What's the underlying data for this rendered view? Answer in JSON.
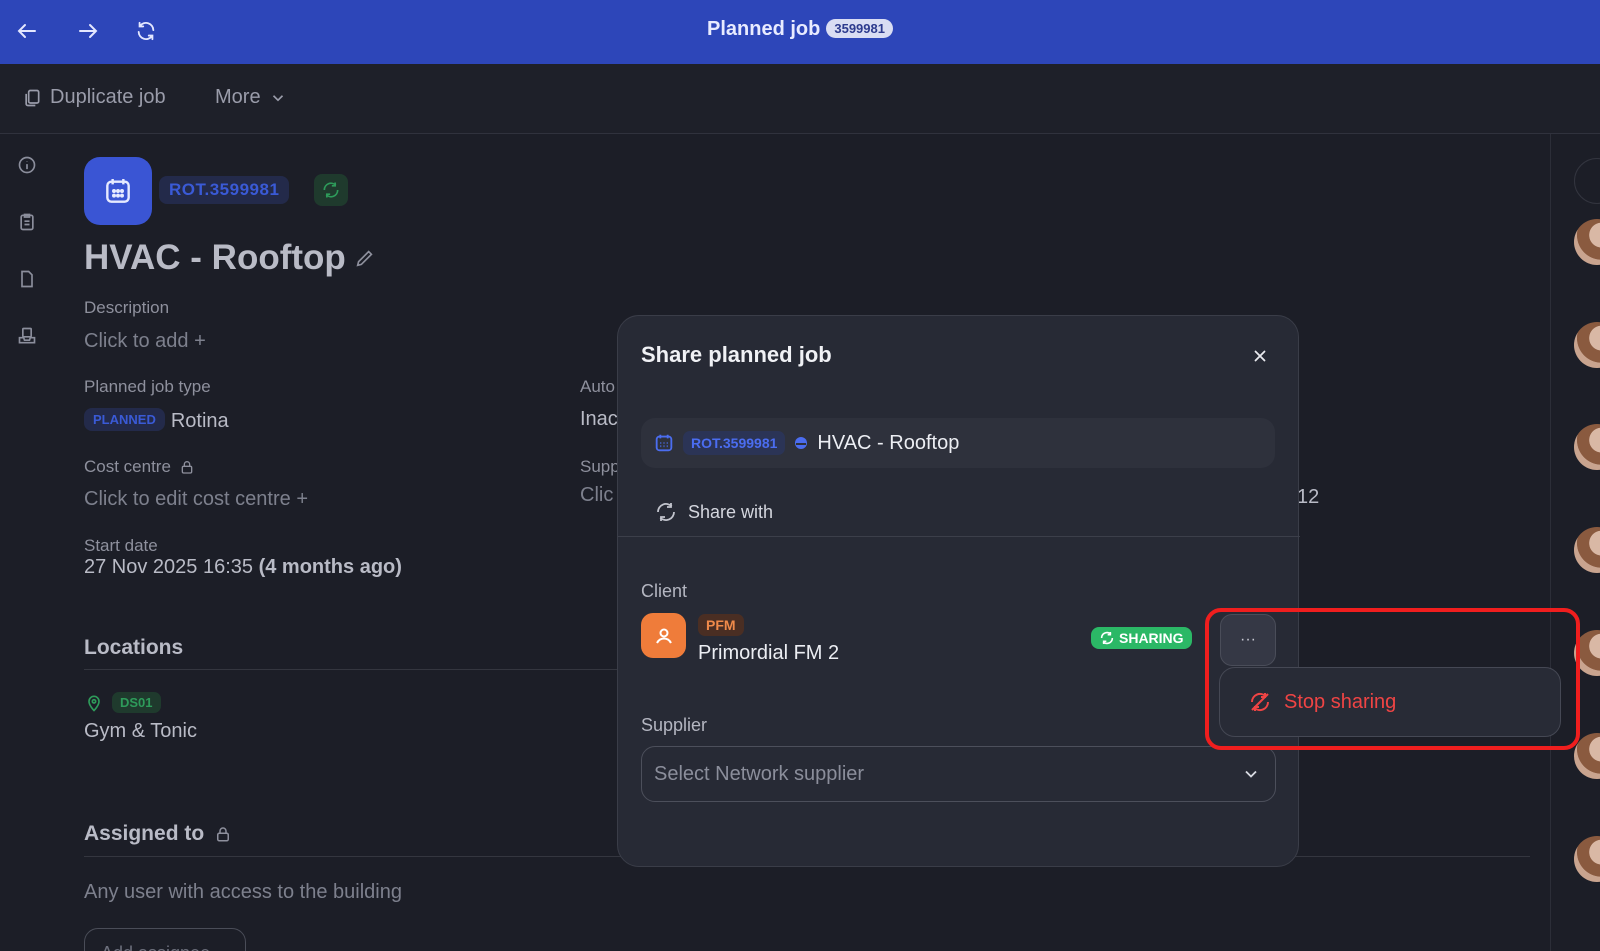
{
  "topbar": {
    "title": "Planned job",
    "badge": "3599981",
    "nav_icons": [
      "back-arrow-icon",
      "forward-arrow-icon",
      "refresh-icon"
    ]
  },
  "toolbar": {
    "duplicate_label": "Duplicate job",
    "more_label": "More"
  },
  "job": {
    "ref": "ROT.3599981",
    "title": "HVAC - Rooftop",
    "description_label": "Description",
    "description_value": "Click to add",
    "type_label": "Planned job type",
    "type_pill": "PLANNED",
    "type_value": "Rotina",
    "cost_centre_label": "Cost centre",
    "cost_centre_value": "Click to edit cost centre",
    "start_label": "Start date",
    "start_value": "27 Nov 2025 16:35",
    "start_relative": "(4 months ago)",
    "auto_label": "Auto",
    "auto_value": "Inac",
    "supp_label": "Supp",
    "supp_value": "Clic",
    "right_fragment": "12",
    "locations_title": "Locations",
    "location_code": "DS01",
    "location_name": "Gym & Tonic",
    "assigned_title": "Assigned to",
    "assigned_value": "Any user with access to the building",
    "add_assignee": "Add assignee"
  },
  "modal": {
    "title": "Share planned job",
    "job_ref": "ROT.3599981",
    "job_name": "HVAC - Rooftop",
    "share_with_label": "Share with",
    "client_label": "Client",
    "client_code": "PFM",
    "client_name": "Primordial FM 2",
    "sharing_badge": "SHARING",
    "more_label": "···",
    "supplier_label": "Supplier",
    "supplier_placeholder": "Select Network supplier"
  },
  "popover": {
    "stop_sharing_label": "Stop sharing"
  },
  "colors": {
    "topbar": "#2d46b9",
    "accent_blue": "#3a55d4",
    "sharing_green": "#2bb866",
    "danger_red": "#ef4444",
    "client_orange": "#ef7c3a"
  }
}
